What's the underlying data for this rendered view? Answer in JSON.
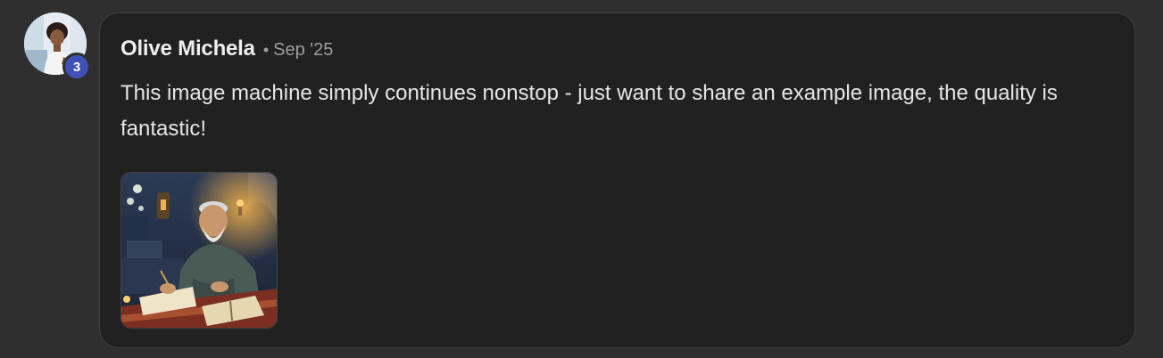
{
  "post": {
    "author": "Olive Michela",
    "separator": "•",
    "date": "Sep '25",
    "message": "This image machine simply continues nonstop - just want to share an example image, the quality is fantastic!",
    "avatar_badge": "3"
  },
  "icons": {
    "avatar": "user-avatar-photo",
    "attachment": "attached-image-thumbnail"
  },
  "colors": {
    "page_background": "#2f2f2f",
    "card_background": "#212121",
    "badge": "#3f51b5",
    "text_primary": "#e6e6e6",
    "text_muted": "#9e9e9e"
  }
}
